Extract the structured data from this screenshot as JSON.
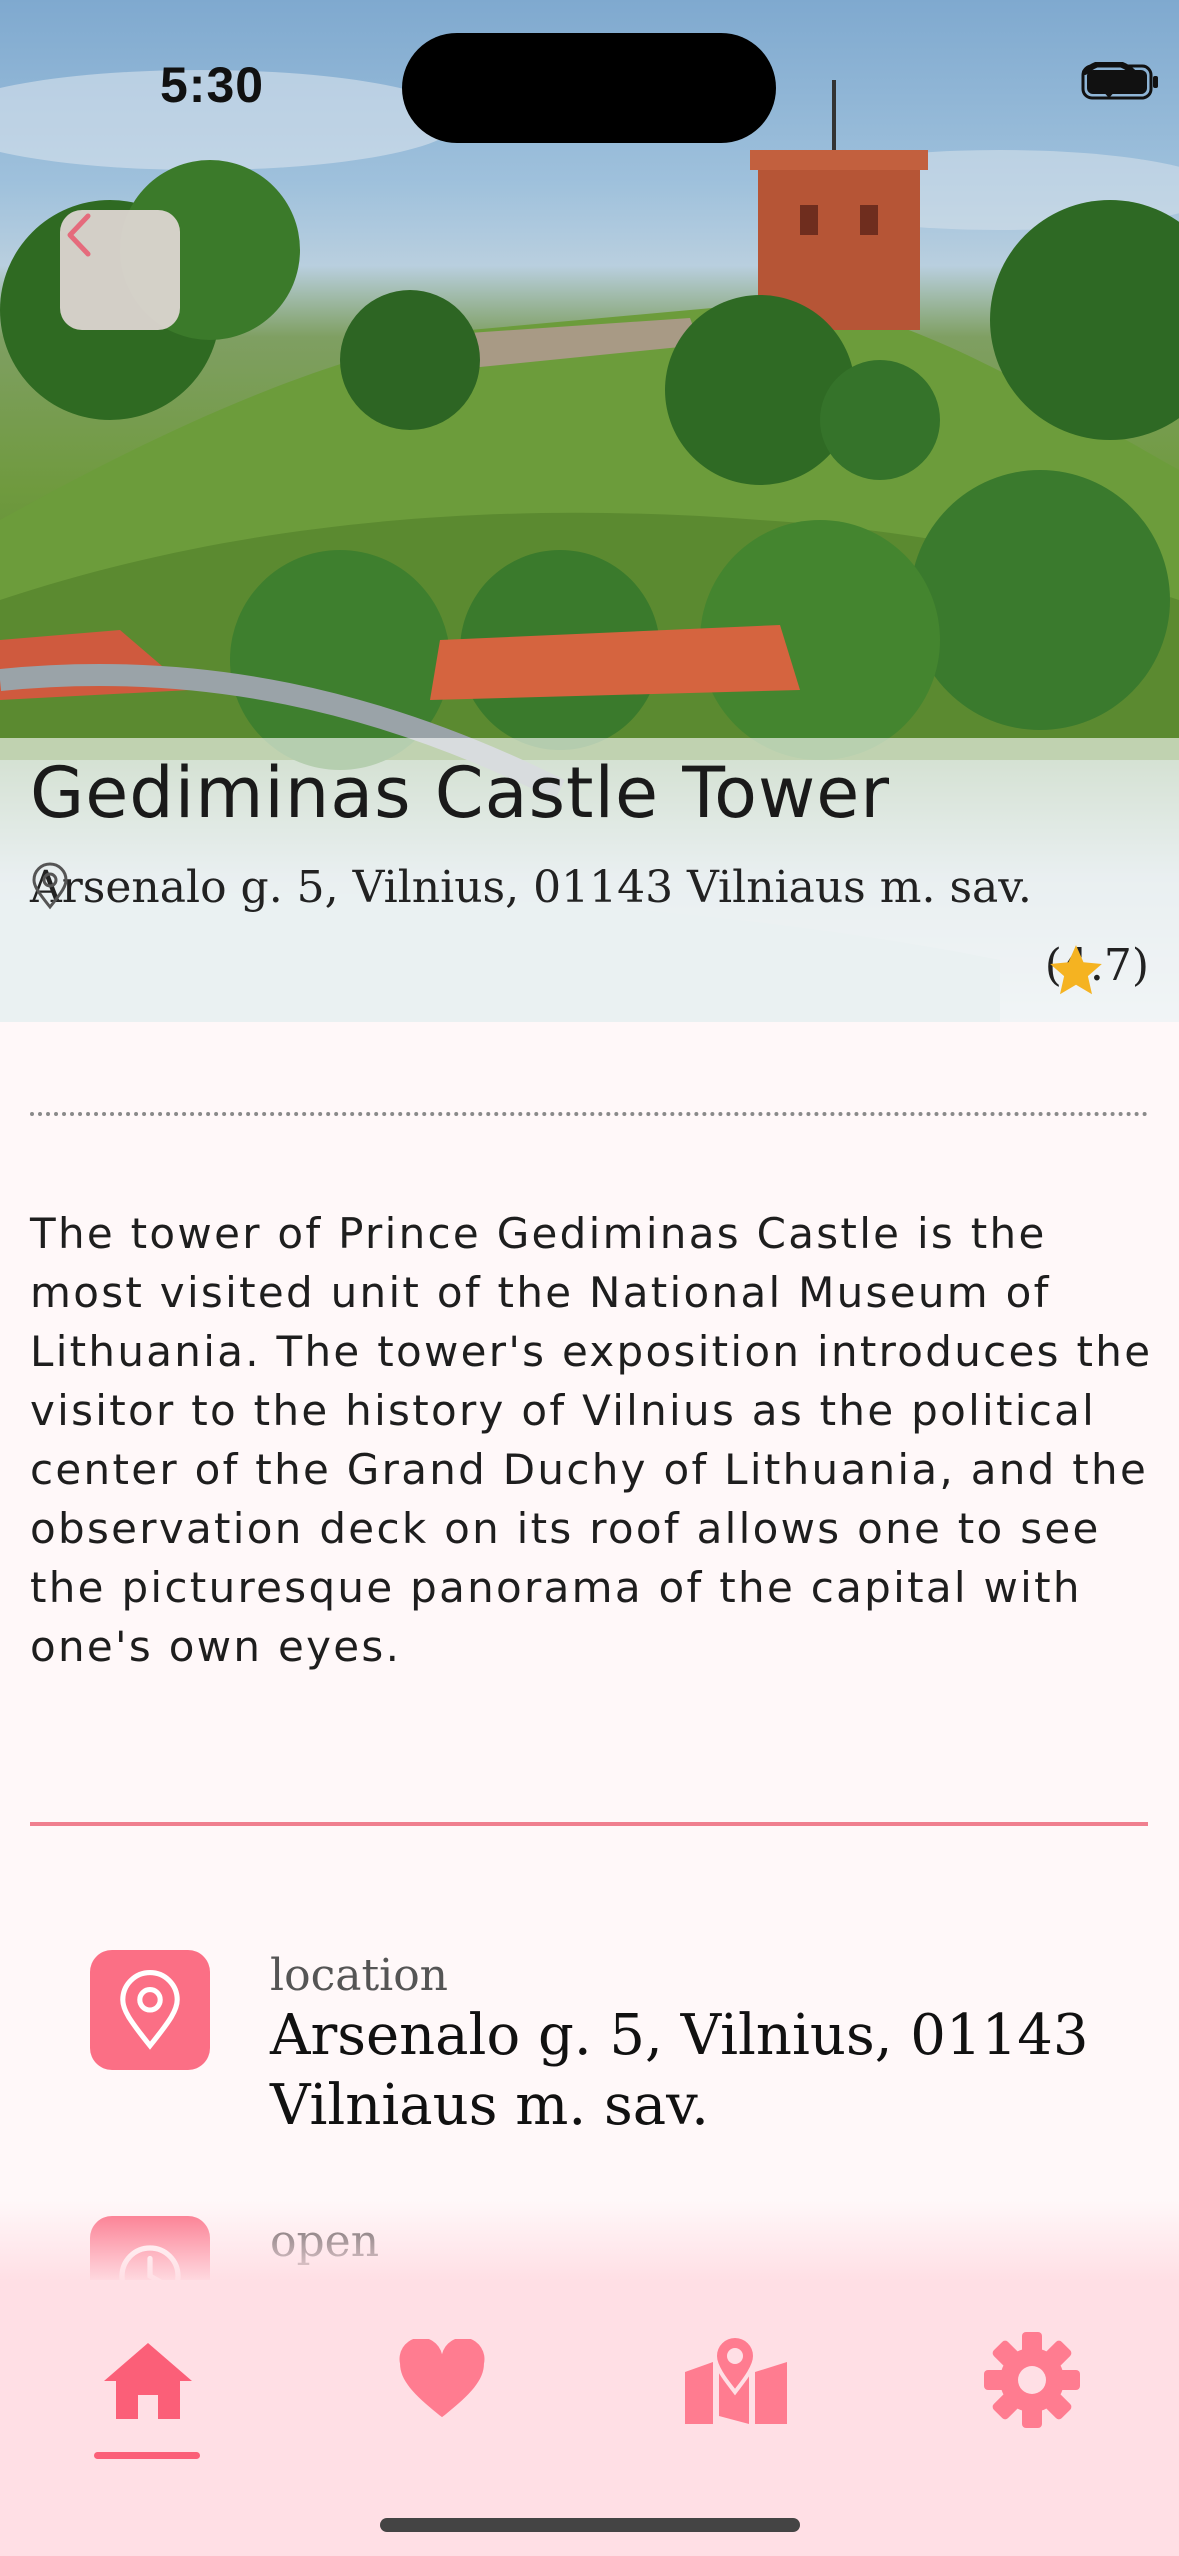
{
  "status_bar": {
    "time": "5:30"
  },
  "place": {
    "title": "Gediminas Castle Tower",
    "address": "Arsenalo g. 5, Vilnius, 01143 Vilniaus m. sav.",
    "rating": "(4.7)",
    "description": "The tower of Prince Gediminas Castle is the most visited unit of the National Museum of Lithuania. The tower's exposition introduces the visitor to the history of Vilnius as the political center of the Grand Duchy of Lithuania, and the observation deck on its roof allows one to see the picturesque panorama of the capital with one's own eyes."
  },
  "info": {
    "location_label": "location",
    "location_value": "Arsenalo g. 5, Vilnius, 01143 Vilniaus m. sav.",
    "open_label": "open"
  },
  "tabs": [
    {
      "name": "home-icon",
      "active": true
    },
    {
      "name": "heart-icon",
      "active": false
    },
    {
      "name": "map-icon",
      "active": false
    },
    {
      "name": "gear-icon",
      "active": false
    }
  ],
  "colors": {
    "accent": "#fb6f85",
    "tabbar_bg": "#ffdfe5",
    "rule": "#f07f8f",
    "star": "#f5b321"
  }
}
